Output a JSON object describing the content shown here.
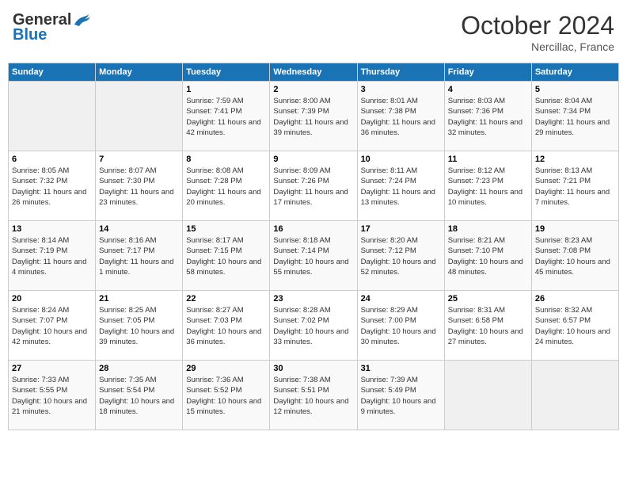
{
  "header": {
    "logo_general": "General",
    "logo_blue": "Blue",
    "month": "October 2024",
    "location": "Nercillac, France"
  },
  "weekdays": [
    "Sunday",
    "Monday",
    "Tuesday",
    "Wednesday",
    "Thursday",
    "Friday",
    "Saturday"
  ],
  "weeks": [
    [
      {
        "day": "",
        "info": ""
      },
      {
        "day": "",
        "info": ""
      },
      {
        "day": "1",
        "info": "Sunrise: 7:59 AM\nSunset: 7:41 PM\nDaylight: 11 hours and 42 minutes."
      },
      {
        "day": "2",
        "info": "Sunrise: 8:00 AM\nSunset: 7:39 PM\nDaylight: 11 hours and 39 minutes."
      },
      {
        "day": "3",
        "info": "Sunrise: 8:01 AM\nSunset: 7:38 PM\nDaylight: 11 hours and 36 minutes."
      },
      {
        "day": "4",
        "info": "Sunrise: 8:03 AM\nSunset: 7:36 PM\nDaylight: 11 hours and 32 minutes."
      },
      {
        "day": "5",
        "info": "Sunrise: 8:04 AM\nSunset: 7:34 PM\nDaylight: 11 hours and 29 minutes."
      }
    ],
    [
      {
        "day": "6",
        "info": "Sunrise: 8:05 AM\nSunset: 7:32 PM\nDaylight: 11 hours and 26 minutes."
      },
      {
        "day": "7",
        "info": "Sunrise: 8:07 AM\nSunset: 7:30 PM\nDaylight: 11 hours and 23 minutes."
      },
      {
        "day": "8",
        "info": "Sunrise: 8:08 AM\nSunset: 7:28 PM\nDaylight: 11 hours and 20 minutes."
      },
      {
        "day": "9",
        "info": "Sunrise: 8:09 AM\nSunset: 7:26 PM\nDaylight: 11 hours and 17 minutes."
      },
      {
        "day": "10",
        "info": "Sunrise: 8:11 AM\nSunset: 7:24 PM\nDaylight: 11 hours and 13 minutes."
      },
      {
        "day": "11",
        "info": "Sunrise: 8:12 AM\nSunset: 7:23 PM\nDaylight: 11 hours and 10 minutes."
      },
      {
        "day": "12",
        "info": "Sunrise: 8:13 AM\nSunset: 7:21 PM\nDaylight: 11 hours and 7 minutes."
      }
    ],
    [
      {
        "day": "13",
        "info": "Sunrise: 8:14 AM\nSunset: 7:19 PM\nDaylight: 11 hours and 4 minutes."
      },
      {
        "day": "14",
        "info": "Sunrise: 8:16 AM\nSunset: 7:17 PM\nDaylight: 11 hours and 1 minute."
      },
      {
        "day": "15",
        "info": "Sunrise: 8:17 AM\nSunset: 7:15 PM\nDaylight: 10 hours and 58 minutes."
      },
      {
        "day": "16",
        "info": "Sunrise: 8:18 AM\nSunset: 7:14 PM\nDaylight: 10 hours and 55 minutes."
      },
      {
        "day": "17",
        "info": "Sunrise: 8:20 AM\nSunset: 7:12 PM\nDaylight: 10 hours and 52 minutes."
      },
      {
        "day": "18",
        "info": "Sunrise: 8:21 AM\nSunset: 7:10 PM\nDaylight: 10 hours and 48 minutes."
      },
      {
        "day": "19",
        "info": "Sunrise: 8:23 AM\nSunset: 7:08 PM\nDaylight: 10 hours and 45 minutes."
      }
    ],
    [
      {
        "day": "20",
        "info": "Sunrise: 8:24 AM\nSunset: 7:07 PM\nDaylight: 10 hours and 42 minutes."
      },
      {
        "day": "21",
        "info": "Sunrise: 8:25 AM\nSunset: 7:05 PM\nDaylight: 10 hours and 39 minutes."
      },
      {
        "day": "22",
        "info": "Sunrise: 8:27 AM\nSunset: 7:03 PM\nDaylight: 10 hours and 36 minutes."
      },
      {
        "day": "23",
        "info": "Sunrise: 8:28 AM\nSunset: 7:02 PM\nDaylight: 10 hours and 33 minutes."
      },
      {
        "day": "24",
        "info": "Sunrise: 8:29 AM\nSunset: 7:00 PM\nDaylight: 10 hours and 30 minutes."
      },
      {
        "day": "25",
        "info": "Sunrise: 8:31 AM\nSunset: 6:58 PM\nDaylight: 10 hours and 27 minutes."
      },
      {
        "day": "26",
        "info": "Sunrise: 8:32 AM\nSunset: 6:57 PM\nDaylight: 10 hours and 24 minutes."
      }
    ],
    [
      {
        "day": "27",
        "info": "Sunrise: 7:33 AM\nSunset: 5:55 PM\nDaylight: 10 hours and 21 minutes."
      },
      {
        "day": "28",
        "info": "Sunrise: 7:35 AM\nSunset: 5:54 PM\nDaylight: 10 hours and 18 minutes."
      },
      {
        "day": "29",
        "info": "Sunrise: 7:36 AM\nSunset: 5:52 PM\nDaylight: 10 hours and 15 minutes."
      },
      {
        "day": "30",
        "info": "Sunrise: 7:38 AM\nSunset: 5:51 PM\nDaylight: 10 hours and 12 minutes."
      },
      {
        "day": "31",
        "info": "Sunrise: 7:39 AM\nSunset: 5:49 PM\nDaylight: 10 hours and 9 minutes."
      },
      {
        "day": "",
        "info": ""
      },
      {
        "day": "",
        "info": ""
      }
    ]
  ]
}
